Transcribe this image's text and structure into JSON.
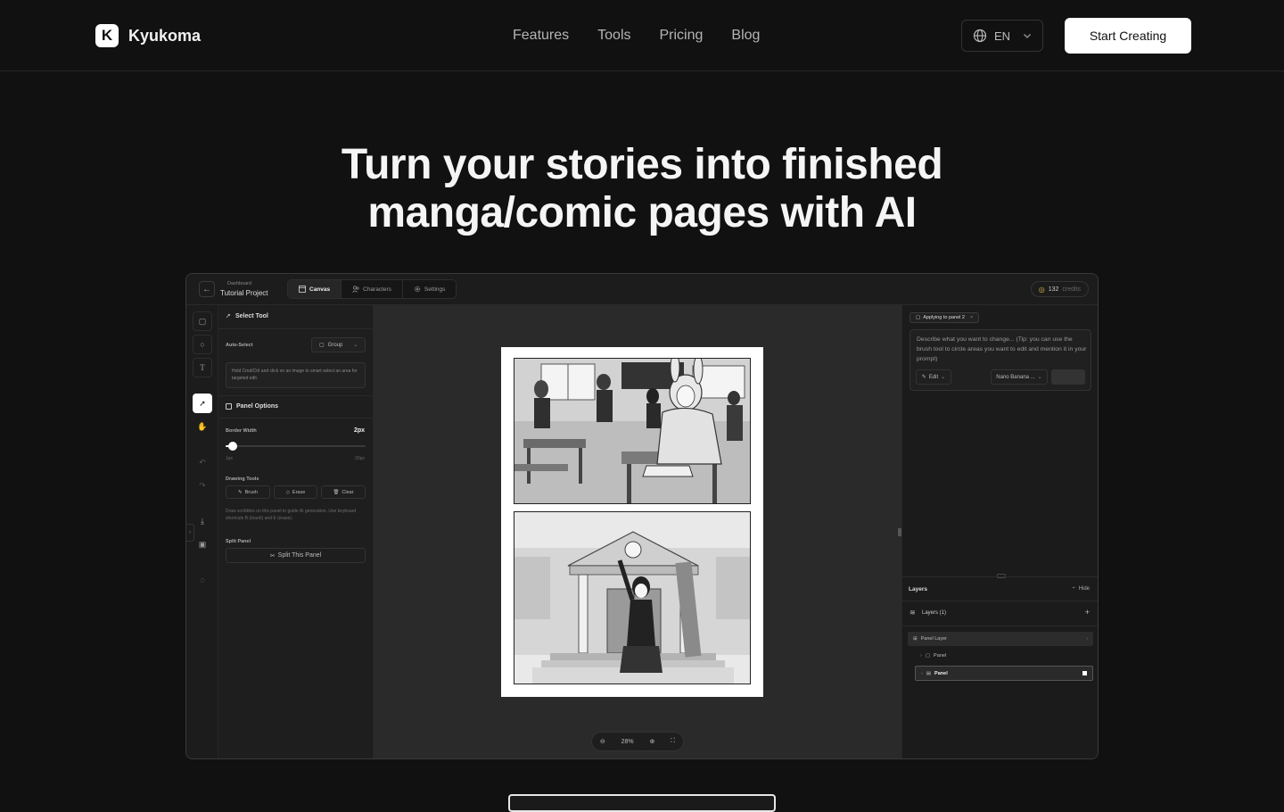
{
  "nav": {
    "brand_mark": "K",
    "brand_name": "Kyukoma",
    "links": [
      "Features",
      "Tools",
      "Pricing",
      "Blog"
    ],
    "language": "EN",
    "cta_label": "Start Creating"
  },
  "hero": {
    "line1": "Turn your stories into finished",
    "line2": "manga/comic pages with AI"
  },
  "app": {
    "breadcrumb_parent": "Dashboard",
    "project_name": "Tutorial Project",
    "tabs": [
      "Canvas",
      "Characters",
      "Settings"
    ],
    "credits_value": "132",
    "credits_label": "credits",
    "tool_panel": {
      "title": "Select Tool",
      "auto_select_label": "Auto-Select",
      "auto_select_value": "Group",
      "hint": "Hold Cmd/Ctrl and click on an image to smart select an area for targeted edit.",
      "panel_options_title": "Panel Options",
      "border_width_label": "Border Width",
      "border_width_value": "2px",
      "slider_min": "1px",
      "slider_max": "20px",
      "border_width_fraction": 0.05,
      "drawing_tools_label": "Drawing Tools",
      "brush_label": "Brush",
      "erase_label": "Erase",
      "clear_label": "Clear",
      "drawing_hint": "Draw scribbles on this panel to guide AI generation. Use keyboard shortcuts B (brush) and E (erase).",
      "split_label": "Split Panel",
      "split_button": "Split This Panel"
    },
    "zoom_value": "28%",
    "right_panel": {
      "chip_label": "Applying to panel 2",
      "prompt_placeholder": "Describe what you want to change... (Tip: you can use the brush tool to circle areas you want to edit and mention it in your prompt)",
      "mode_label": "Edit",
      "model_label": "Nano Banana ...",
      "layers_title": "Layers",
      "hide_label": "Hide",
      "layers_count_label": "Layers (1)",
      "panel_layer_label": "Panel Layer",
      "panel_items": [
        "Panel",
        "Panel"
      ]
    }
  }
}
